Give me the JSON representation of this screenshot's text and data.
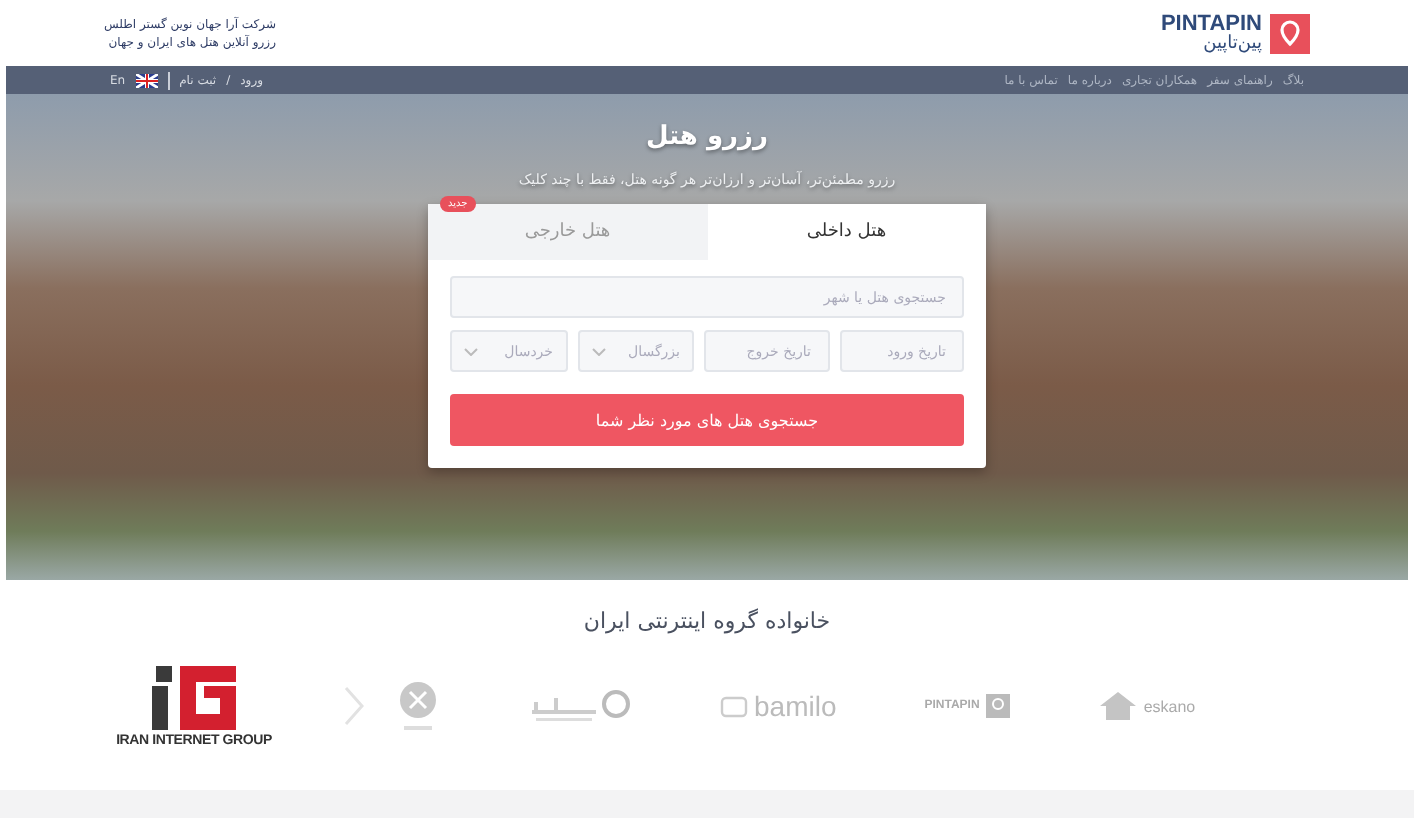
{
  "header": {
    "company_lines": [
      "شرکت آرا جهان نوین گستر اطلس",
      "رزرو آنلاین هتل های ایران و جهان"
    ],
    "logo": {
      "latin": "PINTAPIN",
      "persian": "پین‌تاپین"
    }
  },
  "nav": {
    "links": [
      "بلاگ",
      "راهنمای سفر",
      "همکاران تجاری",
      "درباره ما",
      "تماس با ما"
    ],
    "login": "ورود",
    "separator": "/",
    "register": "ثبت نام",
    "language": "En"
  },
  "hero": {
    "title": "رزرو هتل",
    "subtitle": "رزرو مطمئن‌تر، آسان‌تر و ارزان‌تر هر گونه هتل، فقط با چند کلیک"
  },
  "search": {
    "tabs": [
      {
        "label": "هتل داخلی",
        "selected": true
      },
      {
        "label": "هتل خارجی",
        "selected": false,
        "badge": "جدید"
      }
    ],
    "query": {
      "placeholder": "جستجوی هتل یا شهر"
    },
    "fields": [
      {
        "kind": "date",
        "placeholder": "تاریخ ورود"
      },
      {
        "kind": "date",
        "placeholder": "تاریخ خروج"
      },
      {
        "kind": "select",
        "placeholder": "بزرگسال"
      },
      {
        "kind": "select",
        "placeholder": "خردسال"
      }
    ],
    "button": "جستجوی هتل های مورد نظر شما"
  },
  "family": {
    "title": "خانواده گروه اینترنتی ایران",
    "group_logo": "IRAN INTERNET GROUP",
    "partners": [
      {
        "kind": "house",
        "text": "eskano"
      },
      {
        "kind": "pintapin",
        "text": "PINTAPIN"
      },
      {
        "kind": "bamilo",
        "text": "bamilo"
      },
      {
        "kind": "pin"
      },
      {
        "kind": "round"
      }
    ]
  }
}
